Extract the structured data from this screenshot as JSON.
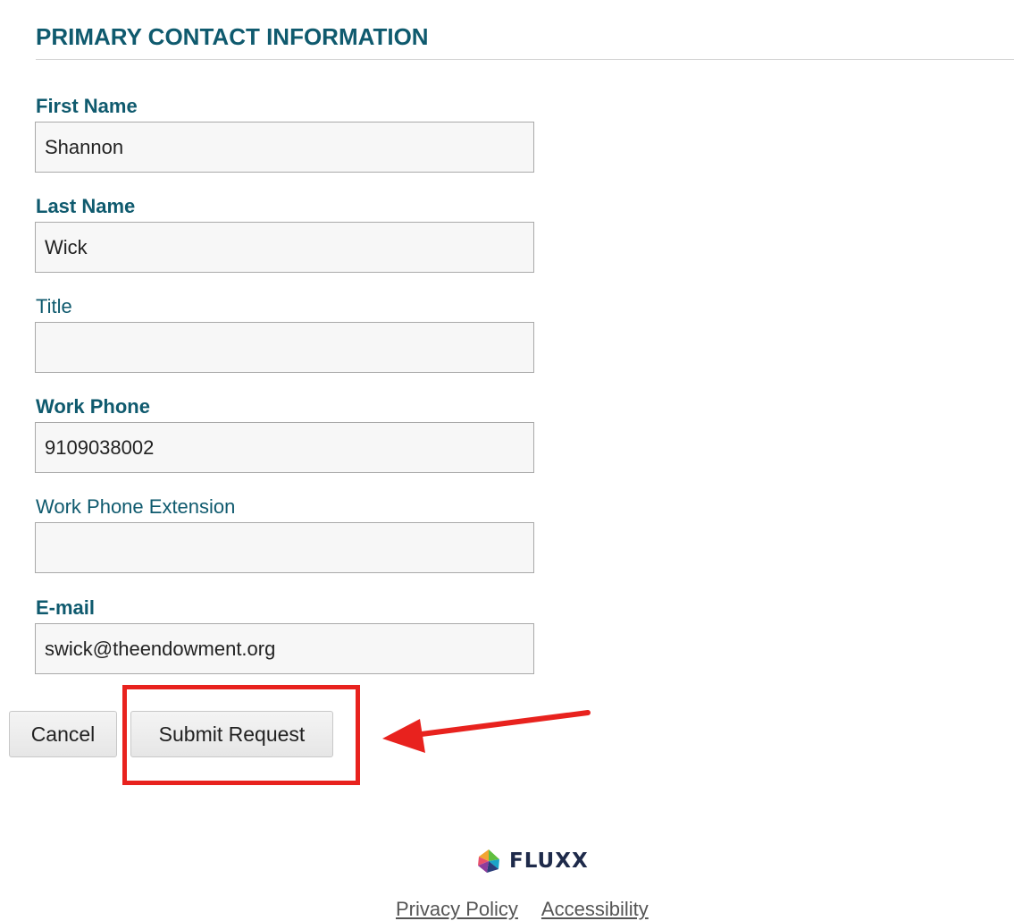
{
  "section": {
    "title": "PRIMARY CONTACT INFORMATION"
  },
  "fields": {
    "first_name": {
      "label": "First Name",
      "value": "Shannon",
      "required": true
    },
    "last_name": {
      "label": "Last Name",
      "value": "Wick",
      "required": true
    },
    "title": {
      "label": "Title",
      "value": "",
      "required": false
    },
    "work_phone": {
      "label": "Work Phone",
      "value": "9109038002",
      "required": true
    },
    "work_phone_extension": {
      "label": "Work Phone Extension",
      "value": "",
      "required": false
    },
    "email": {
      "label": "E-mail",
      "value": "swick@theendowment.org",
      "required": true
    }
  },
  "actions": {
    "cancel_label": "Cancel",
    "submit_label": "Submit Request"
  },
  "annotation": {
    "highlight_color": "#e8221e"
  },
  "footer": {
    "brand": "FLUXX",
    "links": [
      "Privacy Policy",
      "Accessibility"
    ]
  },
  "colors": {
    "label": "#0f5a6e",
    "input_bg": "#f7f7f7",
    "input_border": "#a9a9a9",
    "brand_text": "#1e2a4a"
  }
}
